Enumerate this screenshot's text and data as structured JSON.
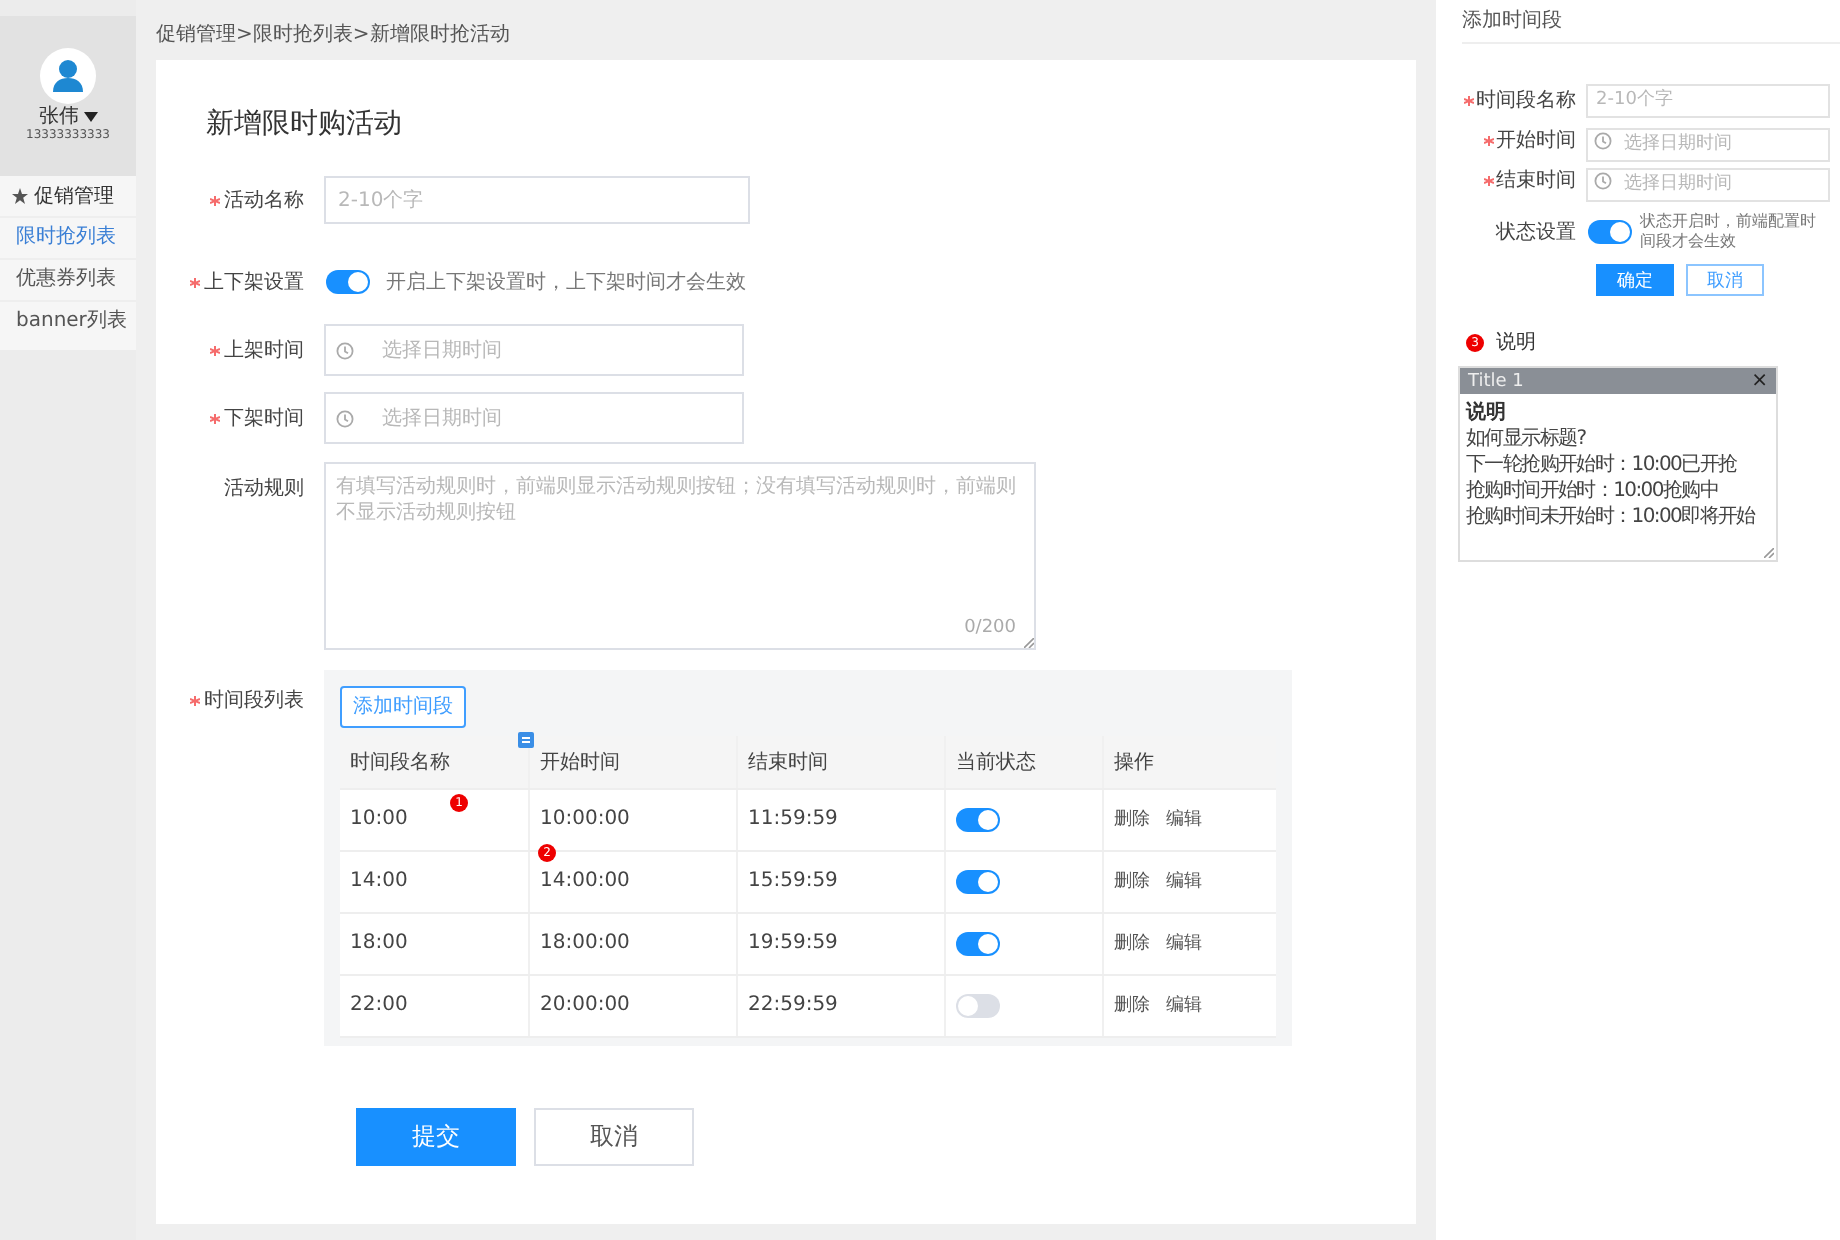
{
  "sidebar": {
    "user": {
      "name": "张伟",
      "phone": "13333333333"
    },
    "menu": {
      "label": "促销管理",
      "items": [
        {
          "label": "限时抢列表",
          "selected": true
        },
        {
          "label": "优惠券列表",
          "selected": false
        },
        {
          "label": "banner列表",
          "selected": false
        }
      ]
    }
  },
  "breadcrumb": "促销管理>限时抢列表>新增限时抢活动",
  "form": {
    "title": "新增限时购活动",
    "fields": [
      {
        "kind": "input",
        "label": "活动名称",
        "required": true,
        "placeholder": "2-10个字"
      },
      {
        "kind": "switch",
        "label": "上下架设置",
        "required": true,
        "on": true,
        "hint": "开启上下架设置时，上下架时间才会生效"
      },
      {
        "kind": "datetime",
        "label": "上架时间",
        "required": true,
        "placeholder": "选择日期时间"
      },
      {
        "kind": "datetime",
        "label": "下架时间",
        "required": true,
        "placeholder": "选择日期时间"
      },
      {
        "kind": "textarea",
        "label": "活动规则",
        "required": false,
        "placeholder": "有填写活动规则时，前端则显示活动规则按钮；没有填写活动规则时，前端则不显示活动规则按钮",
        "counter": "0/200"
      },
      {
        "kind": "table",
        "label": "时间段列表",
        "required": true,
        "add_button": "添加时间段",
        "columns": [
          {
            "label": "时间段名称",
            "note": true
          },
          {
            "label": "开始时间",
            "note": false
          },
          {
            "label": "结束时间",
            "note": false
          },
          {
            "label": "当前状态",
            "note": false
          },
          {
            "label": "操作",
            "note": false
          }
        ],
        "rows": [
          {
            "name": "10:00",
            "name_badge": "1",
            "start": "10:00:00",
            "start_badge": "",
            "end": "11:59:59",
            "on": true,
            "actions": [
              "删除",
              "编辑"
            ]
          },
          {
            "name": "14:00",
            "name_badge": "",
            "start": "14:00:00",
            "start_badge": "2",
            "end": "15:59:59",
            "on": true,
            "actions": [
              "删除",
              "编辑"
            ]
          },
          {
            "name": "18:00",
            "name_badge": "",
            "start": "18:00:00",
            "start_badge": "",
            "end": "19:59:59",
            "on": true,
            "actions": [
              "删除",
              "编辑"
            ]
          },
          {
            "name": "22:00",
            "name_badge": "",
            "start": "20:00:00",
            "start_badge": "",
            "end": "22:59:59",
            "on": false,
            "actions": [
              "删除",
              "编辑"
            ]
          }
        ]
      }
    ],
    "buttons": [
      {
        "label": "提交",
        "primary": true
      },
      {
        "label": "取消",
        "primary": false
      }
    ]
  },
  "dialog": {
    "title": "添加时间段",
    "fields": [
      {
        "kind": "input",
        "label": "时间段名称",
        "required": true,
        "placeholder": "2-10个字"
      },
      {
        "kind": "datetime",
        "label": "开始时间",
        "required": true,
        "placeholder": "选择日期时间"
      },
      {
        "kind": "datetime",
        "label": "结束时间",
        "required": true,
        "placeholder": "选择日期时间"
      },
      {
        "kind": "switch",
        "label": "状态设置",
        "required": false,
        "on": true,
        "hint": "状态开启时，前端配置时间段才会生效"
      }
    ],
    "buttons": [
      {
        "label": "确定",
        "primary": true
      },
      {
        "label": "取消",
        "primary": false
      }
    ]
  },
  "help": {
    "badge": "3",
    "label": "说明",
    "card": {
      "title": "Title 1",
      "close": "×",
      "heading": "说明",
      "lines": [
        "如何显示标题?",
        "下一轮抢购开始时：10:00已开抢",
        "抢购时间开始时：10:00抢购中",
        "抢购时间未开始时：10:00即将开始"
      ]
    }
  }
}
